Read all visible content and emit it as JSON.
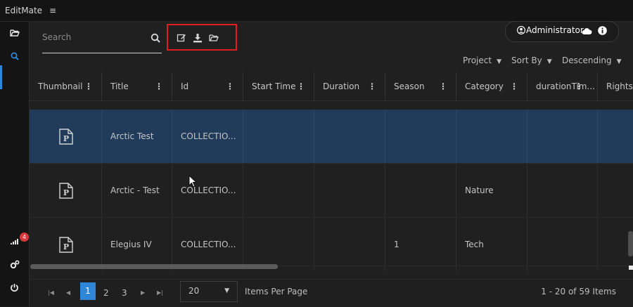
{
  "app": {
    "title": "EditMate",
    "menu_icon": "hamburger-icon"
  },
  "sidebar": {
    "items": [
      {
        "icon": "folder-open-icon"
      },
      {
        "icon": "search-icon",
        "active": true
      },
      {
        "icon": "signal-icon",
        "badge": "4"
      },
      {
        "icon": "cogs-icon"
      },
      {
        "icon": "power-icon"
      }
    ]
  },
  "search": {
    "placeholder": "Search",
    "icon": "search-icon"
  },
  "toolbar": {
    "icons": [
      "edit-icon",
      "download-icon",
      "folder-open-icon"
    ],
    "highlight_color": "#e31b23"
  },
  "user": {
    "name": "Administrator",
    "icons": [
      "user-circle-icon",
      "cloud-icon",
      "info-icon"
    ]
  },
  "sort": {
    "project_label": "Project",
    "sortby_label": "Sort By",
    "order_label": "Descending"
  },
  "table": {
    "columns": [
      "Thumbnail",
      "Title",
      "Id",
      "Start Time",
      "Duration",
      "Season",
      "Category",
      "durationTim...",
      "Rights"
    ],
    "rows": [
      {
        "title": "Arctic Test",
        "id": "COLLECTIO...",
        "start_time": "",
        "duration": "",
        "season": "",
        "category": "",
        "selected": true
      },
      {
        "title": "Arctic - Test",
        "id": "COLLECTIO...",
        "start_time": "",
        "duration": "",
        "season": "",
        "category": "Nature",
        "selected": false
      },
      {
        "title": "Elegius IV",
        "id": "COLLECTIO...",
        "start_time": "",
        "duration": "",
        "season": "1",
        "category": "Tech",
        "selected": false
      }
    ]
  },
  "pagination": {
    "pages": [
      "1",
      "2",
      "3"
    ],
    "current": "1",
    "per_page": "20",
    "per_page_label": "Items Per Page",
    "range": "1 - 20 of 59 Items"
  },
  "colors": {
    "accent": "#2f86d6",
    "selected_row": "#213b5a",
    "badge": "#d9383a"
  }
}
